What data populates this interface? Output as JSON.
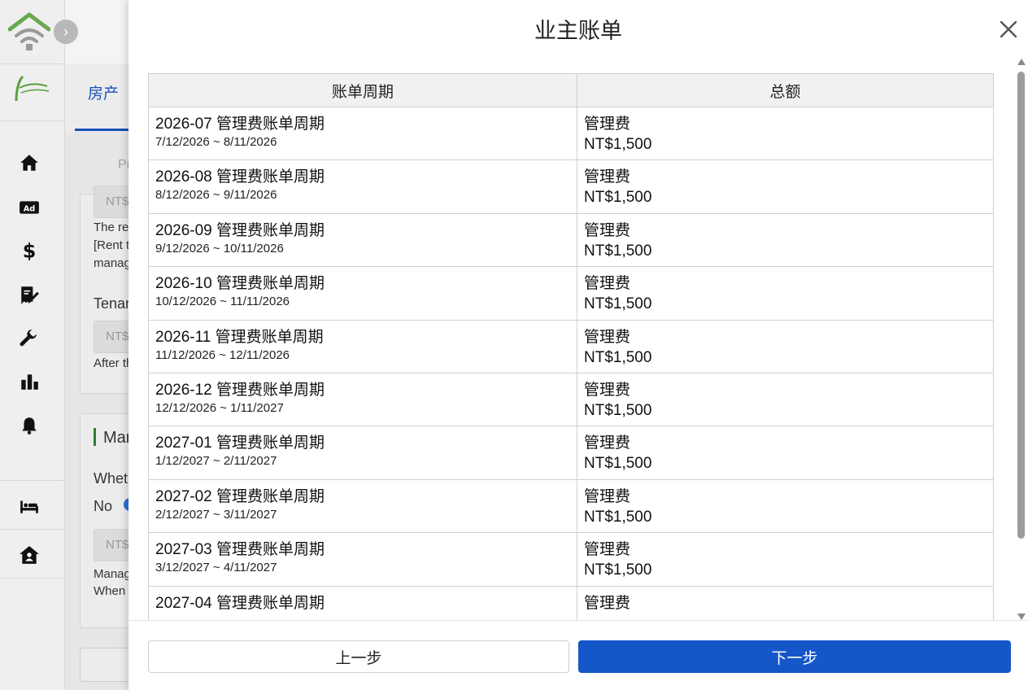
{
  "background": {
    "tab_label": "房产",
    "pr_label": "Pr",
    "inputs": [
      "NT$",
      "NT$",
      "NT$"
    ],
    "texts": [
      "The ret",
      "[Rent t",
      "manag",
      "Tenan",
      "After th",
      "Mar",
      "Wheth",
      "No",
      "Manag",
      "When"
    ]
  },
  "modal": {
    "title": "业主账单",
    "headers": [
      "账单周期",
      "总额"
    ],
    "rows": [
      {
        "title": "2026-07 管理费账单周期",
        "range": "7/12/2026 ~ 8/11/2026",
        "fee": "管理费",
        "amount": "NT$1,500"
      },
      {
        "title": "2026-08 管理费账单周期",
        "range": "8/12/2026 ~ 9/11/2026",
        "fee": "管理费",
        "amount": "NT$1,500"
      },
      {
        "title": "2026-09 管理费账单周期",
        "range": "9/12/2026 ~ 10/11/2026",
        "fee": "管理费",
        "amount": "NT$1,500"
      },
      {
        "title": "2026-10 管理费账单周期",
        "range": "10/12/2026 ~ 11/11/2026",
        "fee": "管理费",
        "amount": "NT$1,500"
      },
      {
        "title": "2026-11 管理费账单周期",
        "range": "11/12/2026 ~ 12/11/2026",
        "fee": "管理费",
        "amount": "NT$1,500"
      },
      {
        "title": "2026-12 管理费账单周期",
        "range": "12/12/2026 ~ 1/11/2027",
        "fee": "管理费",
        "amount": "NT$1,500"
      },
      {
        "title": "2027-01 管理费账单周期",
        "range": "1/12/2027 ~ 2/11/2027",
        "fee": "管理费",
        "amount": "NT$1,500"
      },
      {
        "title": "2027-02 管理费账单周期",
        "range": "2/12/2027 ~ 3/11/2027",
        "fee": "管理费",
        "amount": "NT$1,500"
      },
      {
        "title": "2027-03 管理费账单周期",
        "range": "3/12/2027 ~ 4/11/2027",
        "fee": "管理费",
        "amount": "NT$1,500"
      },
      {
        "title": "2027-04 管理费账单周期",
        "range": "",
        "fee": "管理费",
        "amount": ""
      }
    ],
    "prev_label": "上一步",
    "next_label": "下一步"
  },
  "colors": {
    "primary": "#1556c9",
    "brand_green": "#5a9e3a"
  }
}
